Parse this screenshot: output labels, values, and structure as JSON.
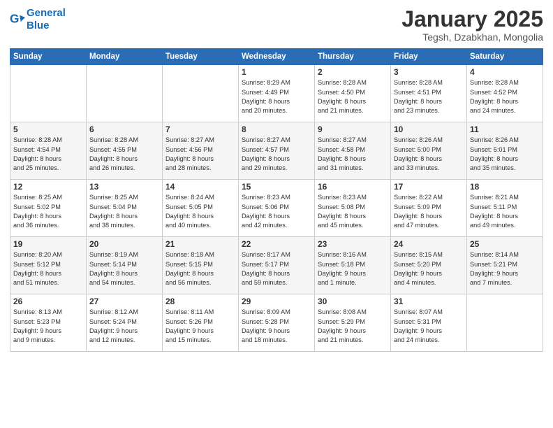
{
  "header": {
    "logo_line1": "General",
    "logo_line2": "Blue",
    "month": "January 2025",
    "location": "Tegsh, Dzabkhan, Mongolia"
  },
  "days_of_week": [
    "Sunday",
    "Monday",
    "Tuesday",
    "Wednesday",
    "Thursday",
    "Friday",
    "Saturday"
  ],
  "weeks": [
    [
      {
        "num": "",
        "info": ""
      },
      {
        "num": "",
        "info": ""
      },
      {
        "num": "",
        "info": ""
      },
      {
        "num": "1",
        "info": "Sunrise: 8:29 AM\nSunset: 4:49 PM\nDaylight: 8 hours\nand 20 minutes."
      },
      {
        "num": "2",
        "info": "Sunrise: 8:28 AM\nSunset: 4:50 PM\nDaylight: 8 hours\nand 21 minutes."
      },
      {
        "num": "3",
        "info": "Sunrise: 8:28 AM\nSunset: 4:51 PM\nDaylight: 8 hours\nand 23 minutes."
      },
      {
        "num": "4",
        "info": "Sunrise: 8:28 AM\nSunset: 4:52 PM\nDaylight: 8 hours\nand 24 minutes."
      }
    ],
    [
      {
        "num": "5",
        "info": "Sunrise: 8:28 AM\nSunset: 4:54 PM\nDaylight: 8 hours\nand 25 minutes."
      },
      {
        "num": "6",
        "info": "Sunrise: 8:28 AM\nSunset: 4:55 PM\nDaylight: 8 hours\nand 26 minutes."
      },
      {
        "num": "7",
        "info": "Sunrise: 8:27 AM\nSunset: 4:56 PM\nDaylight: 8 hours\nand 28 minutes."
      },
      {
        "num": "8",
        "info": "Sunrise: 8:27 AM\nSunset: 4:57 PM\nDaylight: 8 hours\nand 29 minutes."
      },
      {
        "num": "9",
        "info": "Sunrise: 8:27 AM\nSunset: 4:58 PM\nDaylight: 8 hours\nand 31 minutes."
      },
      {
        "num": "10",
        "info": "Sunrise: 8:26 AM\nSunset: 5:00 PM\nDaylight: 8 hours\nand 33 minutes."
      },
      {
        "num": "11",
        "info": "Sunrise: 8:26 AM\nSunset: 5:01 PM\nDaylight: 8 hours\nand 35 minutes."
      }
    ],
    [
      {
        "num": "12",
        "info": "Sunrise: 8:25 AM\nSunset: 5:02 PM\nDaylight: 8 hours\nand 36 minutes."
      },
      {
        "num": "13",
        "info": "Sunrise: 8:25 AM\nSunset: 5:04 PM\nDaylight: 8 hours\nand 38 minutes."
      },
      {
        "num": "14",
        "info": "Sunrise: 8:24 AM\nSunset: 5:05 PM\nDaylight: 8 hours\nand 40 minutes."
      },
      {
        "num": "15",
        "info": "Sunrise: 8:23 AM\nSunset: 5:06 PM\nDaylight: 8 hours\nand 42 minutes."
      },
      {
        "num": "16",
        "info": "Sunrise: 8:23 AM\nSunset: 5:08 PM\nDaylight: 8 hours\nand 45 minutes."
      },
      {
        "num": "17",
        "info": "Sunrise: 8:22 AM\nSunset: 5:09 PM\nDaylight: 8 hours\nand 47 minutes."
      },
      {
        "num": "18",
        "info": "Sunrise: 8:21 AM\nSunset: 5:11 PM\nDaylight: 8 hours\nand 49 minutes."
      }
    ],
    [
      {
        "num": "19",
        "info": "Sunrise: 8:20 AM\nSunset: 5:12 PM\nDaylight: 8 hours\nand 51 minutes."
      },
      {
        "num": "20",
        "info": "Sunrise: 8:19 AM\nSunset: 5:14 PM\nDaylight: 8 hours\nand 54 minutes."
      },
      {
        "num": "21",
        "info": "Sunrise: 8:18 AM\nSunset: 5:15 PM\nDaylight: 8 hours\nand 56 minutes."
      },
      {
        "num": "22",
        "info": "Sunrise: 8:17 AM\nSunset: 5:17 PM\nDaylight: 8 hours\nand 59 minutes."
      },
      {
        "num": "23",
        "info": "Sunrise: 8:16 AM\nSunset: 5:18 PM\nDaylight: 9 hours\nand 1 minute."
      },
      {
        "num": "24",
        "info": "Sunrise: 8:15 AM\nSunset: 5:20 PM\nDaylight: 9 hours\nand 4 minutes."
      },
      {
        "num": "25",
        "info": "Sunrise: 8:14 AM\nSunset: 5:21 PM\nDaylight: 9 hours\nand 7 minutes."
      }
    ],
    [
      {
        "num": "26",
        "info": "Sunrise: 8:13 AM\nSunset: 5:23 PM\nDaylight: 9 hours\nand 9 minutes."
      },
      {
        "num": "27",
        "info": "Sunrise: 8:12 AM\nSunset: 5:24 PM\nDaylight: 9 hours\nand 12 minutes."
      },
      {
        "num": "28",
        "info": "Sunrise: 8:11 AM\nSunset: 5:26 PM\nDaylight: 9 hours\nand 15 minutes."
      },
      {
        "num": "29",
        "info": "Sunrise: 8:09 AM\nSunset: 5:28 PM\nDaylight: 9 hours\nand 18 minutes."
      },
      {
        "num": "30",
        "info": "Sunrise: 8:08 AM\nSunset: 5:29 PM\nDaylight: 9 hours\nand 21 minutes."
      },
      {
        "num": "31",
        "info": "Sunrise: 8:07 AM\nSunset: 5:31 PM\nDaylight: 9 hours\nand 24 minutes."
      },
      {
        "num": "",
        "info": ""
      }
    ]
  ]
}
